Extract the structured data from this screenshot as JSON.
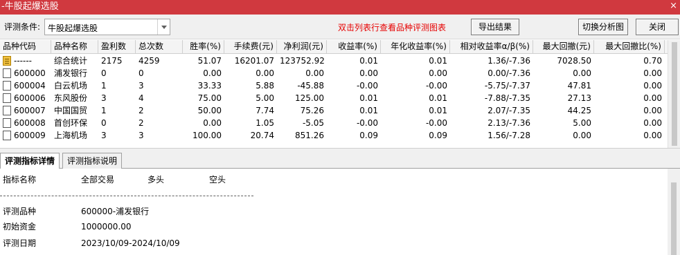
{
  "window": {
    "title": "-牛股起爆选股",
    "close_glyph": "×"
  },
  "toolbar": {
    "condition_label": "评测条件:",
    "condition_value": "牛股起爆选股",
    "hint": "双击列表行查看品种评测图表",
    "export_label": "导出结果",
    "switch_label": "切换分析图",
    "close_label": "关闭"
  },
  "table": {
    "headers": [
      "品种代码",
      "品种名称",
      "盈利数",
      "总次数",
      "胜率(%)",
      "手续费(元)",
      "净利润(元)",
      "收益率(%)",
      "年化收益率(%)",
      "相对收益率α/β(%)",
      "最大回撤(元)",
      "最大回撤比(%)"
    ],
    "rows": [
      [
        "------",
        "综合统计",
        "2175",
        "4259",
        "51.07",
        "16201.07",
        "123752.92",
        "0.01",
        "0.01",
        "1.36/-7.36",
        "7028.50",
        "0.70"
      ],
      [
        "600000",
        "浦发银行",
        "0",
        "0",
        "0.00",
        "0.00",
        "0.00",
        "0.00",
        "0.00",
        "0.00/-7.36",
        "0.00",
        "0.00"
      ],
      [
        "600004",
        "白云机场",
        "1",
        "3",
        "33.33",
        "5.88",
        "-45.88",
        "-0.00",
        "-0.00",
        "-5.75/-7.37",
        "47.81",
        "0.00"
      ],
      [
        "600006",
        "东风股份",
        "3",
        "4",
        "75.00",
        "5.00",
        "125.00",
        "0.01",
        "0.01",
        "-7.88/-7.35",
        "27.13",
        "0.00"
      ],
      [
        "600007",
        "中国国贸",
        "1",
        "2",
        "50.00",
        "7.74",
        "75.26",
        "0.01",
        "0.01",
        "2.07/-7.35",
        "44.25",
        "0.00"
      ],
      [
        "600008",
        "首创环保",
        "0",
        "2",
        "0.00",
        "1.05",
        "-5.05",
        "-0.00",
        "-0.00",
        "2.13/-7.36",
        "5.00",
        "0.00"
      ],
      [
        "600009",
        "上海机场",
        "3",
        "3",
        "100.00",
        "20.74",
        "851.26",
        "0.09",
        "0.09",
        "1.56/-7.28",
        "0.00",
        "0.00"
      ]
    ]
  },
  "tabs": {
    "active": "评测指标详情",
    "inactive": "评测指标说明"
  },
  "detail": {
    "headers": [
      "指标名称",
      "全部交易",
      "多头",
      "空头"
    ],
    "rows": [
      [
        "评测品种",
        "600000-浦发银行"
      ],
      [
        "初始资金",
        "1000000.00"
      ],
      [
        "评测日期",
        "2023/10/09-2024/10/09"
      ]
    ]
  }
}
